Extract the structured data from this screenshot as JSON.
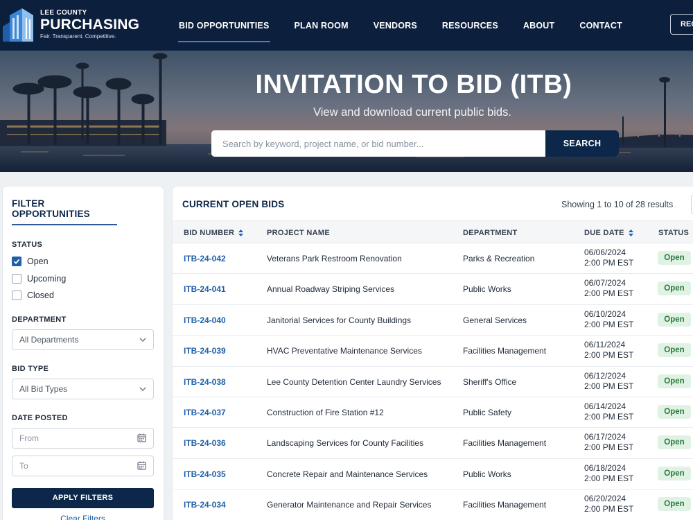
{
  "brand": {
    "county": "LEE COUNTY",
    "name": "PURCHASING",
    "tagline": "Fair. Transparent. Competitive."
  },
  "nav": {
    "items": [
      {
        "label": "BID OPPORTUNITIES",
        "active": true
      },
      {
        "label": "PLAN ROOM"
      },
      {
        "label": "VENDORS"
      },
      {
        "label": "RESOURCES"
      },
      {
        "label": "ABOUT"
      },
      {
        "label": "CONTACT"
      }
    ],
    "register_label": "REG"
  },
  "hero": {
    "title": "INVITATION TO BID (ITB)",
    "subtitle": "View and download current public bids.",
    "search_placeholder": "Search by keyword, project name, or bid number...",
    "search_button": "SEARCH"
  },
  "filters": {
    "title": "FILTER OPPORTUNITIES",
    "status_label": "STATUS",
    "status_options": [
      {
        "label": "Open",
        "checked": true
      },
      {
        "label": "Upcoming",
        "checked": false
      },
      {
        "label": "Closed",
        "checked": false
      }
    ],
    "department_label": "DEPARTMENT",
    "department_value": "All Departments",
    "bid_type_label": "BID TYPE",
    "bid_type_value": "All Bid Types",
    "date_posted_label": "DATE POSTED",
    "from_placeholder": "From",
    "to_placeholder": "To",
    "apply_button": "APPLY FILTERS",
    "clear_link": "Clear Filters"
  },
  "bids": {
    "title": "CURRENT OPEN BIDS",
    "count_text": "Showing 1 to 10 of 28 results",
    "columns": {
      "bid_number": "BID NUMBER",
      "project_name": "PROJECT NAME",
      "department": "DEPARTMENT",
      "due_date": "DUE DATE",
      "status": "STATUS"
    },
    "rows": [
      {
        "bid": "ITB-24-042",
        "project": "Veterans Park Restroom Renovation",
        "dept": "Parks & Recreation",
        "date": "06/06/2024",
        "time": "2:00 PM EST",
        "status": "Open"
      },
      {
        "bid": "ITB-24-041",
        "project": "Annual Roadway Striping Services",
        "dept": "Public Works",
        "date": "06/07/2024",
        "time": "2:00 PM EST",
        "status": "Open"
      },
      {
        "bid": "ITB-24-040",
        "project": "Janitorial Services for County Buildings",
        "dept": "General Services",
        "date": "06/10/2024",
        "time": "2:00 PM EST",
        "status": "Open"
      },
      {
        "bid": "ITB-24-039",
        "project": "HVAC Preventative Maintenance Services",
        "dept": "Facilities Management",
        "date": "06/11/2024",
        "time": "2:00 PM EST",
        "status": "Open"
      },
      {
        "bid": "ITB-24-038",
        "project": "Lee County Detention Center Laundry Services",
        "dept": "Sheriff's Office",
        "date": "06/12/2024",
        "time": "2:00 PM EST",
        "status": "Open"
      },
      {
        "bid": "ITB-24-037",
        "project": "Construction of Fire Station #12",
        "dept": "Public Safety",
        "date": "06/14/2024",
        "time": "2:00 PM EST",
        "status": "Open"
      },
      {
        "bid": "ITB-24-036",
        "project": "Landscaping Services for County Facilities",
        "dept": "Facilities Management",
        "date": "06/17/2024",
        "time": "2:00 PM EST",
        "status": "Open"
      },
      {
        "bid": "ITB-24-035",
        "project": "Concrete Repair and Maintenance Services",
        "dept": "Public Works",
        "date": "06/18/2024",
        "time": "2:00 PM EST",
        "status": "Open"
      },
      {
        "bid": "ITB-24-034",
        "project": "Generator Maintenance and Repair Services",
        "dept": "Facilities Management",
        "date": "06/20/2024",
        "time": "2:00 PM EST",
        "status": "Open"
      }
    ]
  },
  "colors": {
    "navy": "#0c1f3d",
    "accent_blue": "#1f5fa8",
    "open_badge_bg": "#dff2e3",
    "open_badge_text": "#2b7a3d"
  }
}
